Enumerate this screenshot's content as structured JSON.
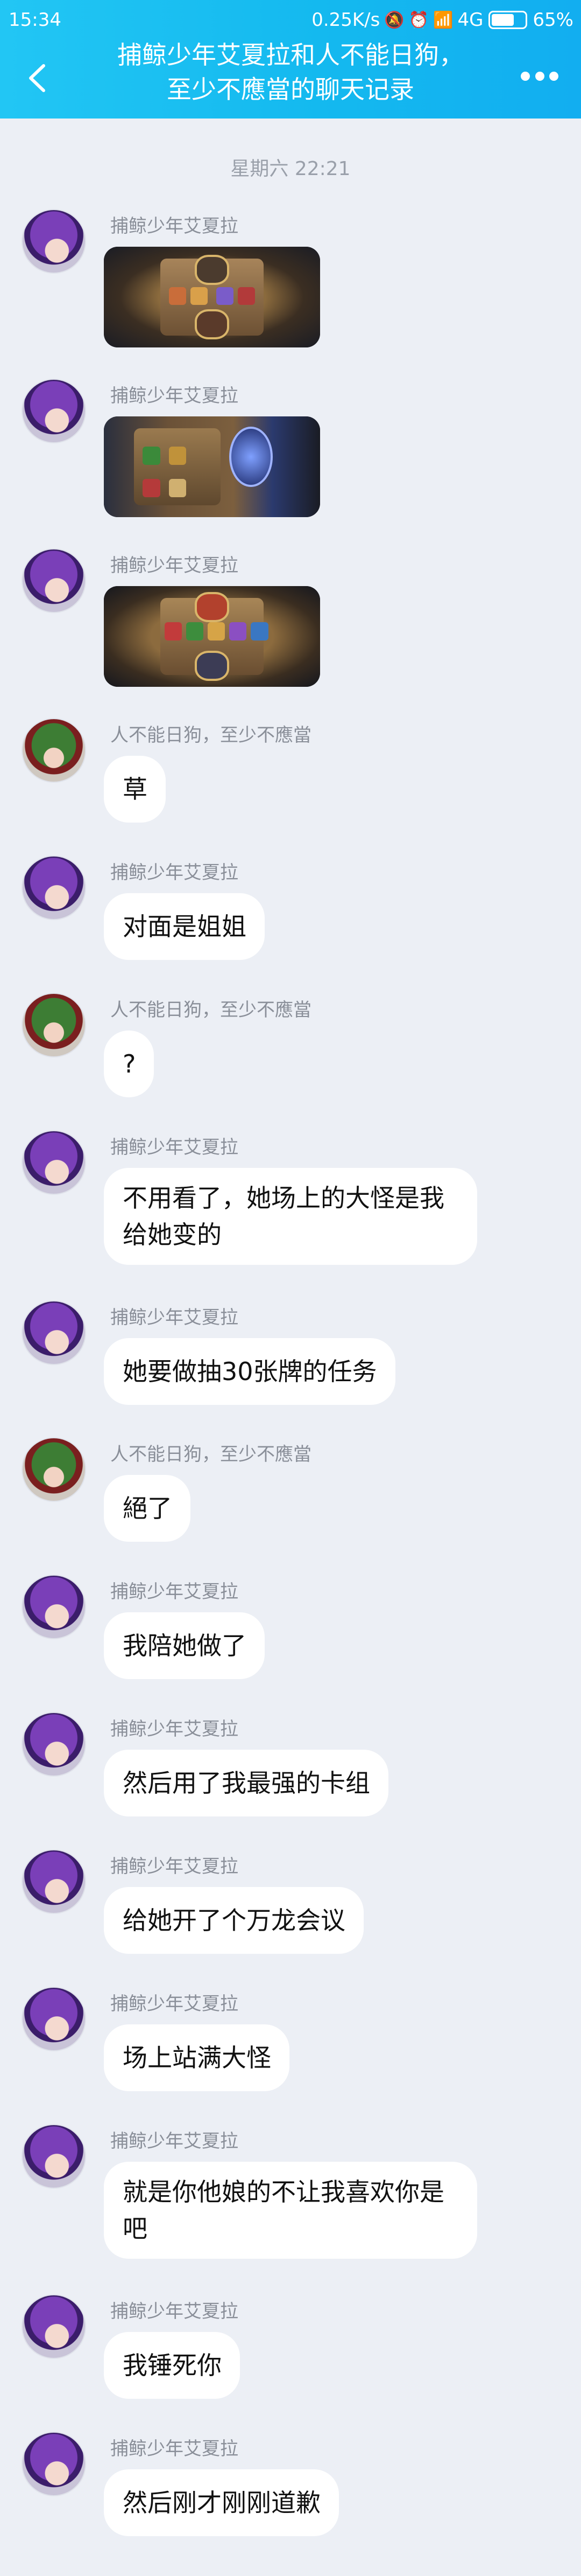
{
  "status_bar": {
    "time": "15:34",
    "net_speed": "0.25K/s",
    "network": "4G",
    "battery": "65%",
    "icons": [
      "mute-icon",
      "alarm-icon",
      "hd-signal-icon",
      "battery-icon"
    ]
  },
  "header": {
    "title_line1": "捕鲸少年艾夏拉和人不能日狗，",
    "title_line2": "至少不應當的聊天记录",
    "back_icon": "chevron-left-icon",
    "more_icon": "more-dots-icon",
    "background": "#1cb9f0"
  },
  "timestamp": "星期六 22:21",
  "senders": {
    "a": "捕鲸少年艾夏拉",
    "b": "人不能日狗，至少不應當"
  },
  "messages": [
    {
      "sender": "捕鲸少年艾夏拉",
      "type": "image",
      "image": "hearthstone-screenshot-1"
    },
    {
      "sender": "捕鲸少年艾夏拉",
      "type": "image",
      "image": "hearthstone-screenshot-2"
    },
    {
      "sender": "捕鲸少年艾夏拉",
      "type": "image",
      "image": "hearthstone-screenshot-3"
    },
    {
      "sender": "人不能日狗，至少不應當",
      "type": "text",
      "text": "草"
    },
    {
      "sender": "捕鲸少年艾夏拉",
      "type": "text",
      "text": "对面是姐姐"
    },
    {
      "sender": "人不能日狗，至少不應當",
      "type": "text",
      "text": "?"
    },
    {
      "sender": "捕鲸少年艾夏拉",
      "type": "text",
      "text": "不用看了，她场上的大怪是我给她变的"
    },
    {
      "sender": "捕鲸少年艾夏拉",
      "type": "text",
      "text": "她要做抽30张牌的任务"
    },
    {
      "sender": "人不能日狗，至少不應當",
      "type": "text",
      "text": "絕了"
    },
    {
      "sender": "捕鲸少年艾夏拉",
      "type": "text",
      "text": "我陪她做了"
    },
    {
      "sender": "捕鲸少年艾夏拉",
      "type": "text",
      "text": "然后用了我最强的卡组"
    },
    {
      "sender": "捕鲸少年艾夏拉",
      "type": "text",
      "text": "给她开了个万龙会议"
    },
    {
      "sender": "捕鲸少年艾夏拉",
      "type": "text",
      "text": "场上站满大怪"
    },
    {
      "sender": "捕鲸少年艾夏拉",
      "type": "text",
      "text": "就是你他娘的不让我喜欢你是吧"
    },
    {
      "sender": "捕鲸少年艾夏拉",
      "type": "text",
      "text": "我锤死你"
    },
    {
      "sender": "捕鲸少年艾夏拉",
      "type": "text",
      "text": "然后刚才刚刚道歉"
    }
  ]
}
